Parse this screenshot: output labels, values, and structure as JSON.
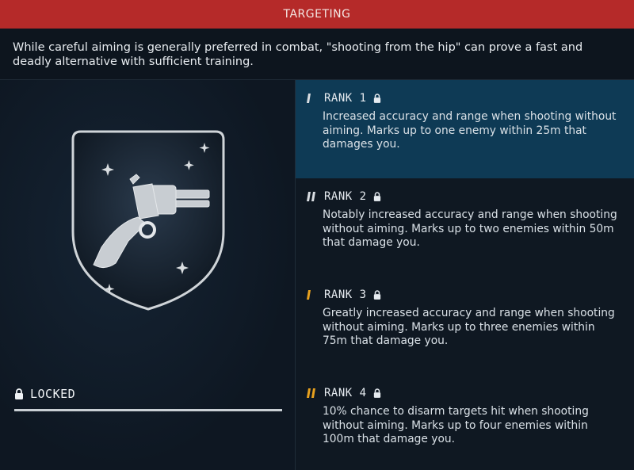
{
  "header": {
    "title": "TARGETING"
  },
  "description": "While careful aiming is generally preferred in combat, \"shooting from the hip\" can prove a fast and deadly alternative with sufficient training.",
  "status": {
    "label": "LOCKED",
    "progress": 1.0
  },
  "ranks": [
    {
      "label": "RANK 1",
      "marks": 1,
      "mark_color": "#d9dde2",
      "active": true,
      "description": "Increased accuracy and range when shooting without aiming. Marks up to one enemy within 25m that damages you."
    },
    {
      "label": "RANK 2",
      "marks": 2,
      "mark_color": "#d9dde2",
      "active": false,
      "description": "Notably increased accuracy and range when shooting without aiming. Marks up to two enemies within 50m that damage you."
    },
    {
      "label": "RANK 3",
      "marks": 1,
      "mark_color": "#e8a11e",
      "active": false,
      "description": "Greatly increased accuracy and range when shooting without aiming. Marks up to three enemies within 75m that damage you."
    },
    {
      "label": "RANK 4",
      "marks": 2,
      "mark_color": "#e8a11e",
      "active": false,
      "description": "10% chance to disarm targets hit when shooting without aiming. Marks up to four enemies within 100m that damage you."
    }
  ],
  "colors": {
    "header_bg": "#b52a29",
    "active_rank_bg": "#0e3a55",
    "gold": "#e8a11e"
  },
  "icons": {
    "skill": "revolver-badge-icon",
    "lock": "lock-icon"
  }
}
